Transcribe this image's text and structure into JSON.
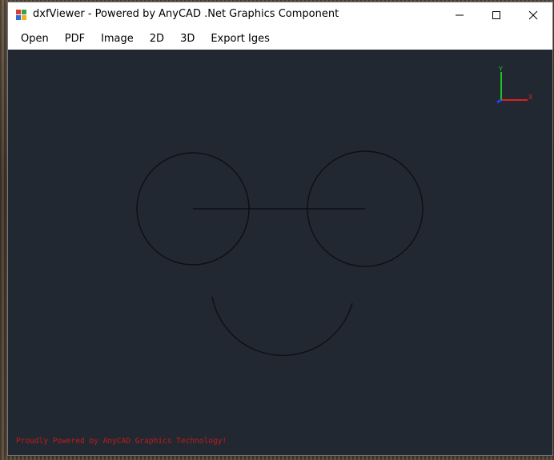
{
  "window": {
    "title": "dxfViewer - Powered by AnyCAD .Net Graphics Component"
  },
  "menu": {
    "items": [
      {
        "id": "open",
        "label": "Open"
      },
      {
        "id": "pdf",
        "label": "PDF"
      },
      {
        "id": "image",
        "label": "Image"
      },
      {
        "id": "2d",
        "label": "2D"
      },
      {
        "id": "3d",
        "label": "3D"
      },
      {
        "id": "export-iges",
        "label": "Export Iges"
      }
    ]
  },
  "viewport": {
    "background": "#222831",
    "line_color": "#0d0f12",
    "footer": "Proudly Powered by AnyCAD Graphics Technology!",
    "axis": {
      "x_label": "X",
      "y_label": "Y",
      "x_color": "#e02020",
      "y_color": "#20c020",
      "z_color": "#2040ff"
    }
  }
}
